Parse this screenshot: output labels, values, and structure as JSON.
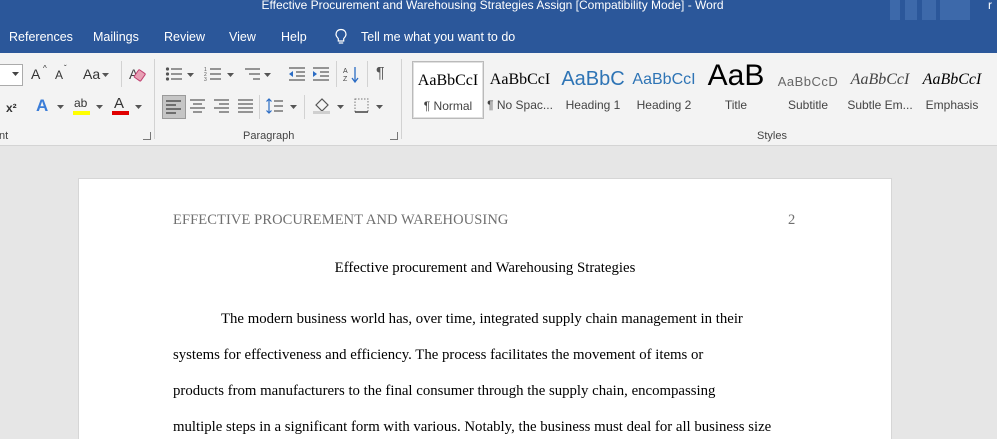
{
  "window": {
    "title": "Effective Procurement and Warehousing Strategies Assign [Compatibility Mode]  -  Word",
    "user_initial": "r"
  },
  "menu": {
    "tabs": [
      "References",
      "Mailings",
      "Review",
      "View",
      "Help"
    ],
    "tell_me": "Tell me what you want to do"
  },
  "ribbon": {
    "font_group_label": "nt",
    "paragraph_group_label": "Paragraph",
    "styles_group_label": "Styles",
    "font_size_up": "A",
    "font_size_down": "A",
    "change_case": "Aa",
    "superscript": "x²",
    "text_effects": "A",
    "highlight": "ab",
    "font_color": "A",
    "pilcrow": "¶",
    "styles": [
      {
        "preview": "AaBbCcI",
        "name": "¶ Normal"
      },
      {
        "preview": "AaBbCcI",
        "name": "¶ No Spac..."
      },
      {
        "preview": "AaBbC",
        "name": "Heading 1"
      },
      {
        "preview": "AaBbCcI",
        "name": "Heading 2"
      },
      {
        "preview": "AaB",
        "name": "Title"
      },
      {
        "preview": "AaBbCcD",
        "name": "Subtitle"
      },
      {
        "preview": "AaBbCcI",
        "name": "Subtle Em..."
      },
      {
        "preview": "AaBbCcI",
        "name": "Emphasis"
      }
    ],
    "colors": {
      "highlight": "#ffff00",
      "font_color": "#e00000"
    }
  },
  "document": {
    "running_head": "EFFECTIVE PROCUREMENT AND WAREHOUSING",
    "page_number": "2",
    "title": "Effective procurement and Warehousing Strategies",
    "lines": [
      "The modern business world has, over time, integrated supply chain management in their",
      "systems for effectiveness and efficiency. The process facilitates the movement of items or",
      "products from manufacturers to the final consumer through the supply chain, encompassing",
      "multiple steps in a significant form with various. Notably, the business must deal for all business size"
    ]
  }
}
